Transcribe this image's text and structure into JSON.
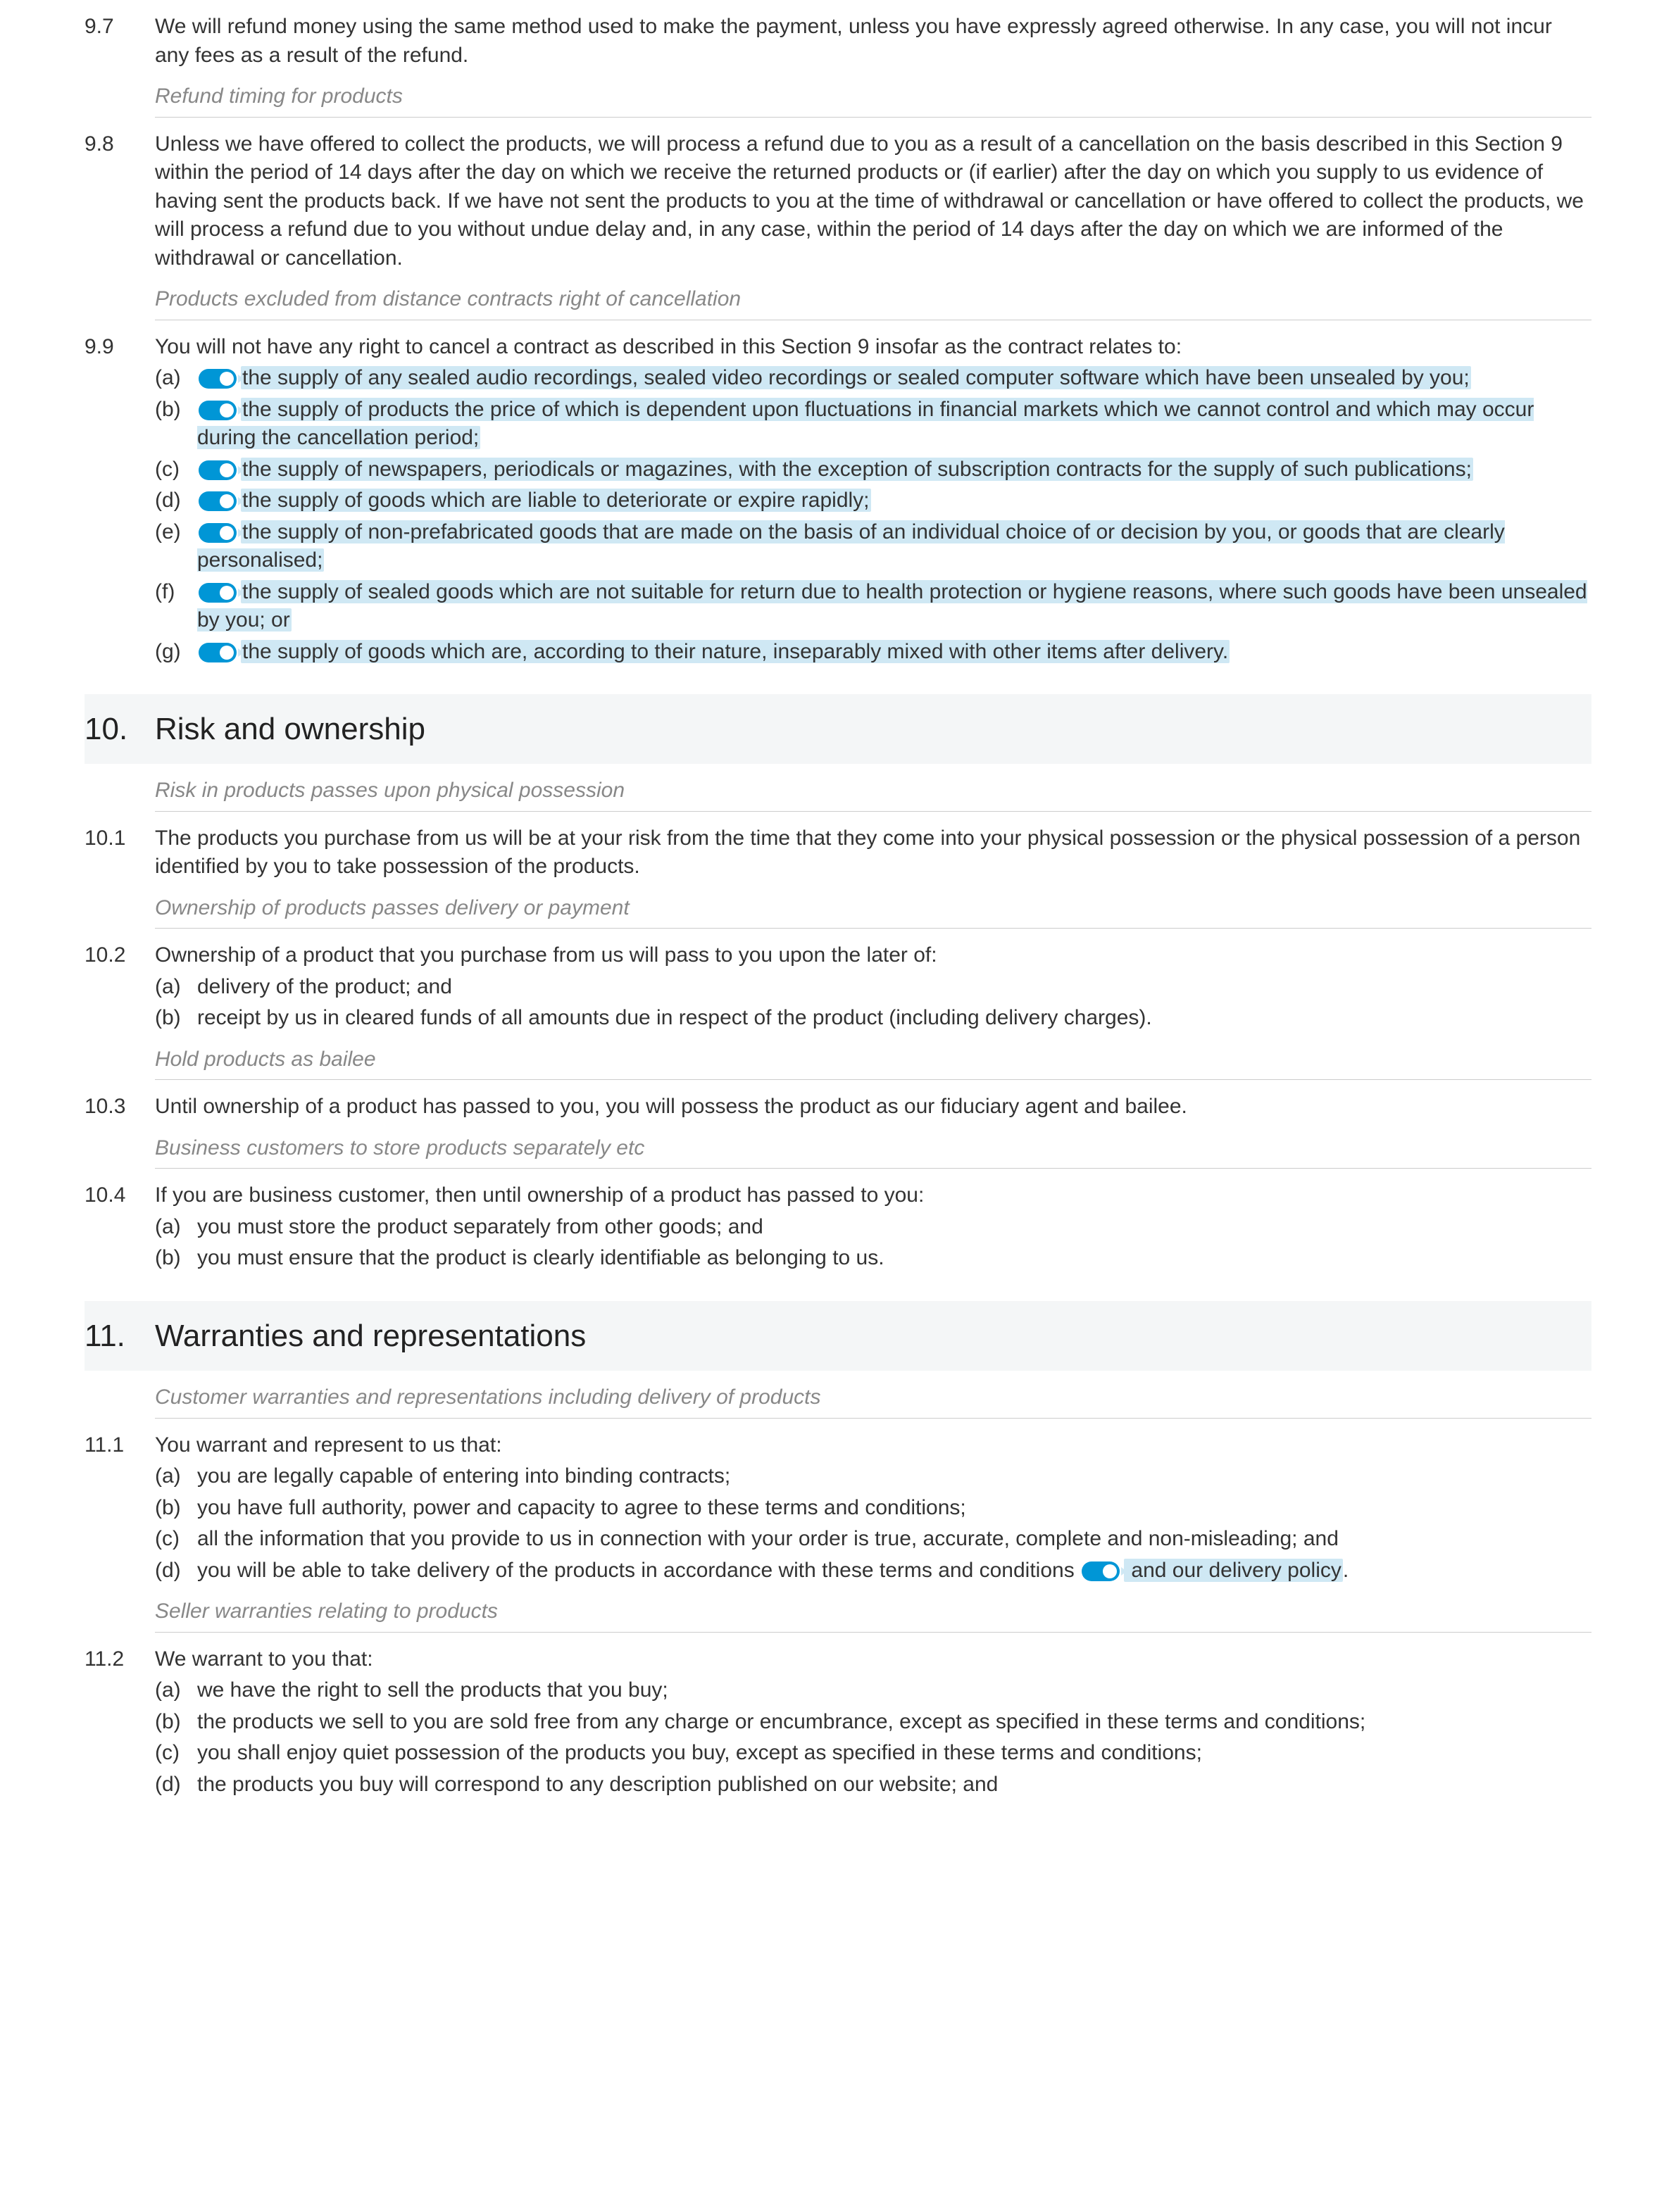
{
  "clauses": {
    "c9_7": {
      "num": "9.7",
      "text": "We will refund money using the same method used to make the payment, unless you have expressly agreed otherwise. In any case, you will not incur any fees as a result of the refund."
    },
    "cap_9_7": "Refund timing for products",
    "c9_8": {
      "num": "9.8",
      "text": "Unless we have offered to collect the products, we will process a refund due to you as a result of a cancellation on the basis described in this Section 9 within the period of 14 days after the day on which we receive the returned products or (if earlier) after the day on which you supply to us evidence of having sent the products back. If we have not sent the products to you at the time of withdrawal or cancellation or have offered to collect the products, we will process a refund due to you without undue delay and, in any case, within the period of 14 days after the day on which we are informed of the withdrawal or cancellation."
    },
    "cap_9_8": "Products excluded from distance contracts right of cancellation",
    "c9_9": {
      "num": "9.9",
      "intro": "You will not have any right to cancel a contract as described in this Section 9 insofar as the contract relates to:",
      "items": [
        {
          "l": "(a)",
          "t": "the supply of any sealed audio recordings, sealed video recordings or sealed computer software which have been unsealed by you;"
        },
        {
          "l": "(b)",
          "t": "the supply of products the price of which is dependent upon fluctuations in financial markets which we cannot control and which may occur during the cancellation period;"
        },
        {
          "l": "(c)",
          "t": "the supply of newspapers, periodicals or magazines, with the exception of subscription contracts for the supply of such publications;"
        },
        {
          "l": "(d)",
          "t": "the supply of goods which are liable to deteriorate or expire rapidly;"
        },
        {
          "l": "(e)",
          "t": "the supply of non-prefabricated goods that are made on the basis of an individual choice of or decision by you, or goods that are clearly personalised;"
        },
        {
          "l": "(f)",
          "t": "the supply of sealed goods which are not suitable for return due to health protection or hygiene reasons, where such goods have been unsealed by you; or"
        },
        {
          "l": "(g)",
          "t": "the supply of goods which are, according to their nature, inseparably mixed with other items after delivery."
        }
      ]
    },
    "s10": {
      "num": "10.",
      "title": "Risk and ownership"
    },
    "cap_10_1": "Risk in products passes upon physical possession",
    "c10_1": {
      "num": "10.1",
      "text": "The products you purchase from us will be at your risk from the time that they come into your physical possession or the physical possession of a person identified by you to take possession of the products."
    },
    "cap_10_2": "Ownership of products passes delivery or payment",
    "c10_2": {
      "num": "10.2",
      "intro": "Ownership of a product that you purchase from us will pass to you upon the later of:",
      "items": [
        {
          "l": "(a)",
          "t": "delivery of the product; and"
        },
        {
          "l": "(b)",
          "t": "receipt by us in cleared funds of all amounts due in respect of the product (including delivery charges)."
        }
      ]
    },
    "cap_10_3": "Hold products as bailee",
    "c10_3": {
      "num": "10.3",
      "text": "Until ownership of a product has passed to you, you will possess the product as our fiduciary agent and bailee."
    },
    "cap_10_4": "Business customers to store products separately etc",
    "c10_4": {
      "num": "10.4",
      "intro": "If you are business customer, then until ownership of a product has passed to you:",
      "items": [
        {
          "l": "(a)",
          "t": "you must store the product separately from other goods; and"
        },
        {
          "l": "(b)",
          "t": "you must ensure that the product is clearly identifiable as belonging to us."
        }
      ]
    },
    "s11": {
      "num": "11.",
      "title": "Warranties and representations"
    },
    "cap_11_1": "Customer warranties and representations including delivery of products",
    "c11_1": {
      "num": "11.1",
      "intro": "You warrant and represent to us that:",
      "items": [
        {
          "l": "(a)",
          "t": "you are legally capable of entering into binding contracts;"
        },
        {
          "l": "(b)",
          "t": "you have full authority, power and capacity to agree to these terms and conditions;"
        },
        {
          "l": "(c)",
          "t": "all the information that you provide to us in connection with your order is true, accurate, complete and non-misleading; and"
        }
      ],
      "d_letter": "(d)",
      "d_pre": "you will be able to take delivery of the products in accordance with these terms and conditions",
      "d_hl": " and our delivery policy",
      "d_post": "."
    },
    "cap_11_2": "Seller warranties relating to products",
    "c11_2": {
      "num": "11.2",
      "intro": "We warrant to you that:",
      "items": [
        {
          "l": "(a)",
          "t": "we have the right to sell the products that you buy;"
        },
        {
          "l": "(b)",
          "t": "the products we sell to you are sold free from any charge or encumbrance, except as specified in these terms and conditions;"
        },
        {
          "l": "(c)",
          "t": "you shall enjoy quiet possession of the products you buy, except as specified in these terms and conditions;"
        },
        {
          "l": "(d)",
          "t": "the products you buy will correspond to any description published on our website; and"
        }
      ]
    }
  }
}
